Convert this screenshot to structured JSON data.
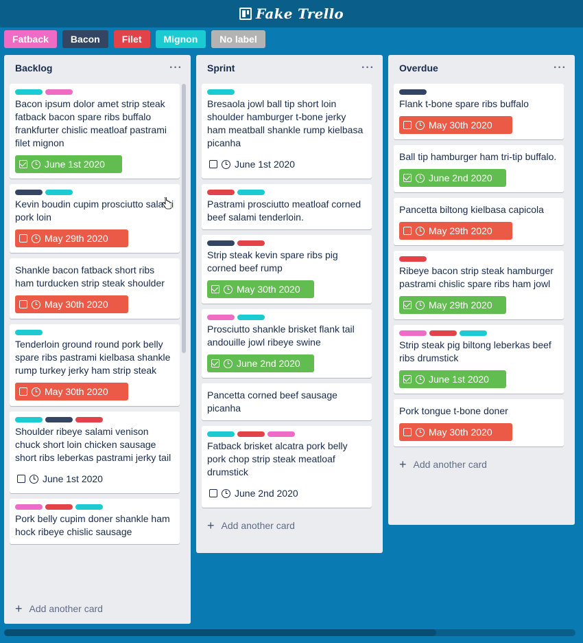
{
  "app": {
    "title": "Fake Trello"
  },
  "colors": {
    "pink": "#ef6cc6",
    "navy": "#344563",
    "red": "#e2434a",
    "cyan": "#1ccbd1",
    "grey": "#b3b3b3",
    "green": "#61bd4f"
  },
  "labels_bar": [
    {
      "text": "Fatback",
      "color": "#ef6cc6"
    },
    {
      "text": "Bacon",
      "color": "#344563"
    },
    {
      "text": "Filet",
      "color": "#e2434a"
    },
    {
      "text": "Mignon",
      "color": "#1ccbd1"
    },
    {
      "text": "No label",
      "color": "#b3b3b3"
    }
  ],
  "lists": [
    {
      "title": "Backlog",
      "cards": [
        {
          "labels": [
            "cyan",
            "pink"
          ],
          "text": "Bacon ipsum dolor amet strip steak fatback bacon spare ribs buffalo frankfurter chislic meatloaf pastrami filet mignon",
          "due": {
            "date": "June 1st 2020",
            "status": "green"
          }
        },
        {
          "labels": [
            "navy",
            "cyan"
          ],
          "text": "Kevin boudin cupim prosciutto salami pork loin",
          "due": {
            "date": "May 29th 2020",
            "status": "red"
          }
        },
        {
          "labels": [],
          "text": "Shankle bacon fatback short ribs ham turducken strip steak shoulder",
          "due": {
            "date": "May 30th 2020",
            "status": "red"
          }
        },
        {
          "labels": [
            "cyan"
          ],
          "text": "Tenderloin ground round pork belly spare ribs pastrami kielbasa shankle rump turkey jerky ham strip steak",
          "due": {
            "date": "May 30th 2020",
            "status": "red"
          }
        },
        {
          "labels": [
            "cyan",
            "navy",
            "red"
          ],
          "text": "Shoulder ribeye salami venison chuck short loin chicken sausage short ribs leberkas pastrami jerky tail",
          "due": {
            "date": "June 1st 2020",
            "status": "plain"
          }
        },
        {
          "labels": [
            "pink",
            "red",
            "cyan"
          ],
          "text": "Pork belly cupim doner shankle ham hock ribeye chislic sausage",
          "due": null
        }
      ],
      "add_card": "Add another card"
    },
    {
      "title": "Sprint",
      "cards": [
        {
          "labels": [
            "cyan"
          ],
          "text": "Bresaola jowl ball tip short loin shoulder hamburger t-bone jerky ham meatball shankle rump kielbasa picanha",
          "due": {
            "date": "June 1st 2020",
            "status": "plain"
          }
        },
        {
          "labels": [
            "red",
            "cyan"
          ],
          "text": "Pastrami prosciutto meatloaf corned beef salami tenderloin.",
          "due": null
        },
        {
          "labels": [
            "navy",
            "red"
          ],
          "text": "Strip steak kevin spare ribs pig corned beef rump",
          "due": {
            "date": "May 30th 2020",
            "status": "green"
          }
        },
        {
          "labels": [
            "pink",
            "cyan"
          ],
          "text": "Prosciutto shankle brisket flank tail andouille jowl ribeye swine",
          "due": {
            "date": "June 2nd 2020",
            "status": "green"
          }
        },
        {
          "labels": [],
          "text": "Pancetta corned beef sausage picanha",
          "due": null
        },
        {
          "labels": [
            "cyan",
            "red",
            "pink"
          ],
          "text": "Fatback brisket alcatra pork belly pork chop strip steak meatloaf drumstick",
          "due": {
            "date": "June 2nd 2020",
            "status": "plain"
          }
        }
      ],
      "add_card": "Add another card"
    },
    {
      "title": "Overdue",
      "cards": [
        {
          "labels": [
            "navy"
          ],
          "text": "Flank t-bone spare ribs buffalo",
          "due": {
            "date": "May 30th 2020",
            "status": "red"
          }
        },
        {
          "labels": [],
          "text": "Ball tip hamburger ham tri-tip buffalo.",
          "due": {
            "date": "June 2nd 2020",
            "status": "green"
          }
        },
        {
          "labels": [],
          "text": "Pancetta biltong kielbasa capicola",
          "due": {
            "date": "May 29th 2020",
            "status": "red"
          }
        },
        {
          "labels": [
            "red"
          ],
          "text": "Ribeye bacon strip steak hamburger pastrami chislic spare ribs ham jowl",
          "due": {
            "date": "May 29th 2020",
            "status": "green"
          }
        },
        {
          "labels": [
            "pink",
            "red",
            "cyan"
          ],
          "text": "Strip steak pig biltong leberkas beef ribs drumstick",
          "due": {
            "date": "June 1st 2020",
            "status": "green"
          }
        },
        {
          "labels": [],
          "text": "Pork tongue t-bone doner",
          "due": {
            "date": "May 30th 2020",
            "status": "red"
          }
        }
      ],
      "add_card": "Add another card"
    }
  ]
}
